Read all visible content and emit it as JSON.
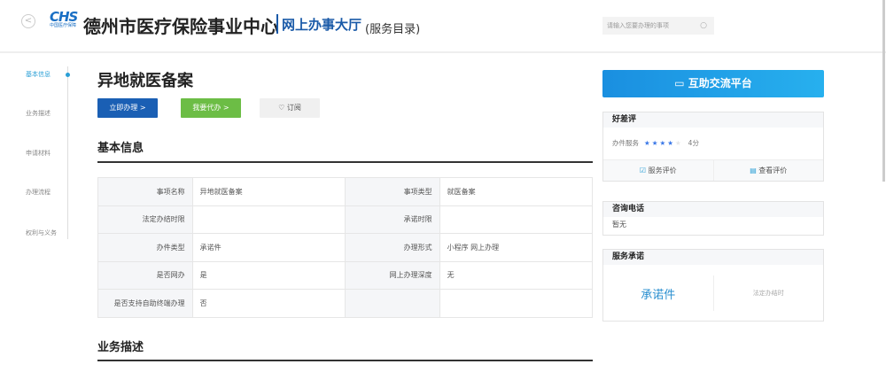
{
  "header": {
    "logo_text": "CHS",
    "logo_sub": "中国医疗保障",
    "org": "德州市医疗保险事业中心",
    "hall": "网上办事大厅",
    "catalog": "(服务目录)",
    "search_placeholder": "请输入您要办理的事项"
  },
  "sidebar": {
    "items": [
      {
        "label": "基本信息",
        "active": true
      },
      {
        "label": "业务描述"
      },
      {
        "label": "申请材料"
      },
      {
        "label": "办理流程"
      },
      {
        "label": "权利与义务"
      }
    ]
  },
  "main": {
    "title": "异地就医备案",
    "buttons": {
      "handle": "立即办理 >",
      "delegate": "我要代办 >",
      "subscribe": "订阅"
    },
    "basic_heading": "基本信息",
    "rows": [
      [
        "事项名称",
        "异地就医备案",
        "事项类型",
        "就医备案"
      ],
      [
        "法定办结时限",
        "",
        "承诺时限",
        ""
      ],
      [
        "办件类型",
        "承诺件",
        "办理形式",
        "小程序 网上办理"
      ],
      [
        "是否网办",
        "是",
        "网上办理深度",
        "无"
      ],
      [
        "是否支持自助终端办理",
        "否",
        "",
        ""
      ]
    ],
    "desc_heading": "业务描述"
  },
  "right": {
    "banner": "互助交流平台",
    "rating": {
      "title": "好差评",
      "label": "办件服务",
      "stars": 4,
      "max": 5,
      "score": "4分",
      "evaluate": "服务评价",
      "view": "查看评价"
    },
    "phone": {
      "title": "咨询电话",
      "value": "暂无"
    },
    "promise": {
      "title": "服务承诺",
      "type": "承诺件",
      "legal": "法定办结时"
    }
  },
  "colors": {
    "primary": "#1a5aa8",
    "green": "#6cbd45",
    "accent": "#2a9fd6"
  }
}
